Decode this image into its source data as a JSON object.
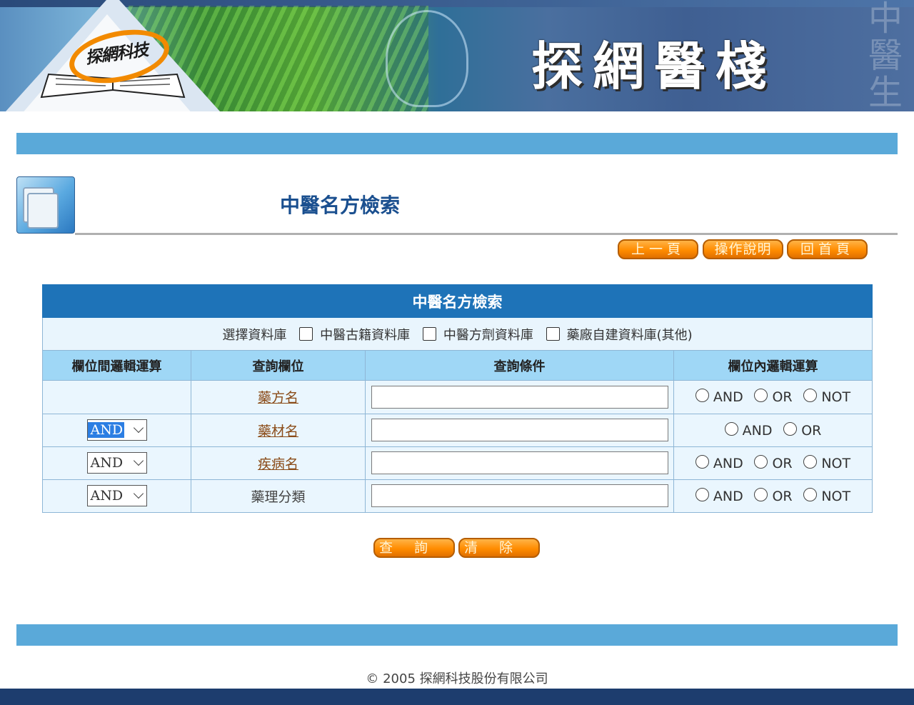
{
  "banner": {
    "logo_text": "探網科技",
    "title": "探網醫棧",
    "watermark": "中醫生醫棧"
  },
  "page": {
    "title": "中醫名方檢索"
  },
  "nav": {
    "prev_label": "上一頁",
    "help_label": "操作說明",
    "home_label": "回首頁"
  },
  "form": {
    "table_title": "中醫名方檢索",
    "db_select_label": "選擇資料庫",
    "databases": [
      {
        "label": "中醫古籍資料庫",
        "checked": false
      },
      {
        "label": "中醫方劑資料庫",
        "checked": false
      },
      {
        "label": "藥廠自建資料庫(其他)",
        "checked": false
      }
    ],
    "headers": {
      "between": "欄位間邏輯運算",
      "field": "查詢欄位",
      "condition": "查詢條件",
      "within": "欄位內邏輯運算"
    },
    "rows": [
      {
        "operator": "",
        "field": "藥方名",
        "link": true,
        "value": "",
        "options": [
          "AND",
          "OR",
          "NOT"
        ]
      },
      {
        "operator": "AND",
        "field": "藥材名",
        "link": true,
        "value": "",
        "options": [
          "AND",
          "OR"
        ]
      },
      {
        "operator": "AND",
        "field": "疾病名",
        "link": true,
        "value": "",
        "options": [
          "AND",
          "OR",
          "NOT"
        ]
      },
      {
        "operator": "AND",
        "field": "藥理分類",
        "link": false,
        "value": "",
        "options": [
          "AND",
          "OR",
          "NOT"
        ]
      }
    ],
    "search_label": "查詢",
    "clear_label": "清除"
  },
  "footer": {
    "copyright": "© 2005 探網科技股份有限公司"
  },
  "colors": {
    "bar": "#5aa9d9",
    "table_title_bg": "#1e73b8",
    "header_bg": "#9fd7f6",
    "row_bg": "#eaf6fe",
    "button_orange": "#ff8c00",
    "page_title": "#1a4f8f",
    "field_link": "#8a4b17",
    "bottom_strip": "#1d3d6e"
  }
}
